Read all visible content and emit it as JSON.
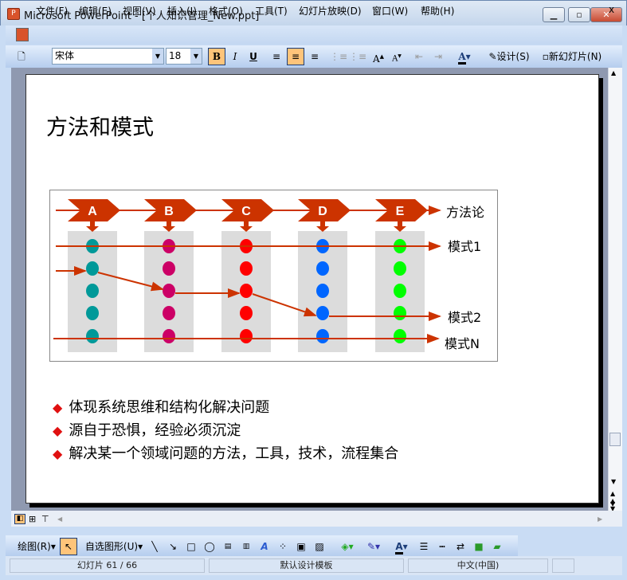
{
  "window": {
    "title": "Microsoft PowerPoint - [个人知识管理_New.ppt]",
    "close_doc": "x"
  },
  "menu": [
    "文件(F)",
    "编辑(E)",
    "视图(V)",
    "插入(I)",
    "格式(O)",
    "工具(T)",
    "幻灯片放映(D)",
    "窗口(W)",
    "帮助(H)"
  ],
  "toolbar": {
    "font": "宋体",
    "size": "18",
    "bold": "B",
    "italic": "I",
    "underline": "U",
    "design": "设计(S)",
    "new_slide": "新幻灯片(N)"
  },
  "slide": {
    "title": "方法和模式",
    "diagram": {
      "steps": [
        "A",
        "B",
        "C",
        "D",
        "E"
      ],
      "column_colors": [
        "#009999",
        "#cc0066",
        "#ff0000",
        "#0066ff",
        "#00ff00"
      ],
      "arrow_color": "#cc3300",
      "labels": {
        "methodology": "方法论",
        "mode1": "模式1",
        "mode2": "模式2",
        "modeN": "模式N"
      }
    },
    "bullets": [
      "体现系统思维和结构化解决问题",
      "源自于恐惧，经验必须沉淀",
      "解决某一个领域问题的方法，工具，技术，流程集合"
    ]
  },
  "drawing": {
    "draw": "绘图(R)",
    "autoshapes": "自选图形(U)"
  },
  "status": {
    "slide": "幻灯片 61 / 66",
    "template": "默认设计模板",
    "language": "中文(中国)"
  }
}
